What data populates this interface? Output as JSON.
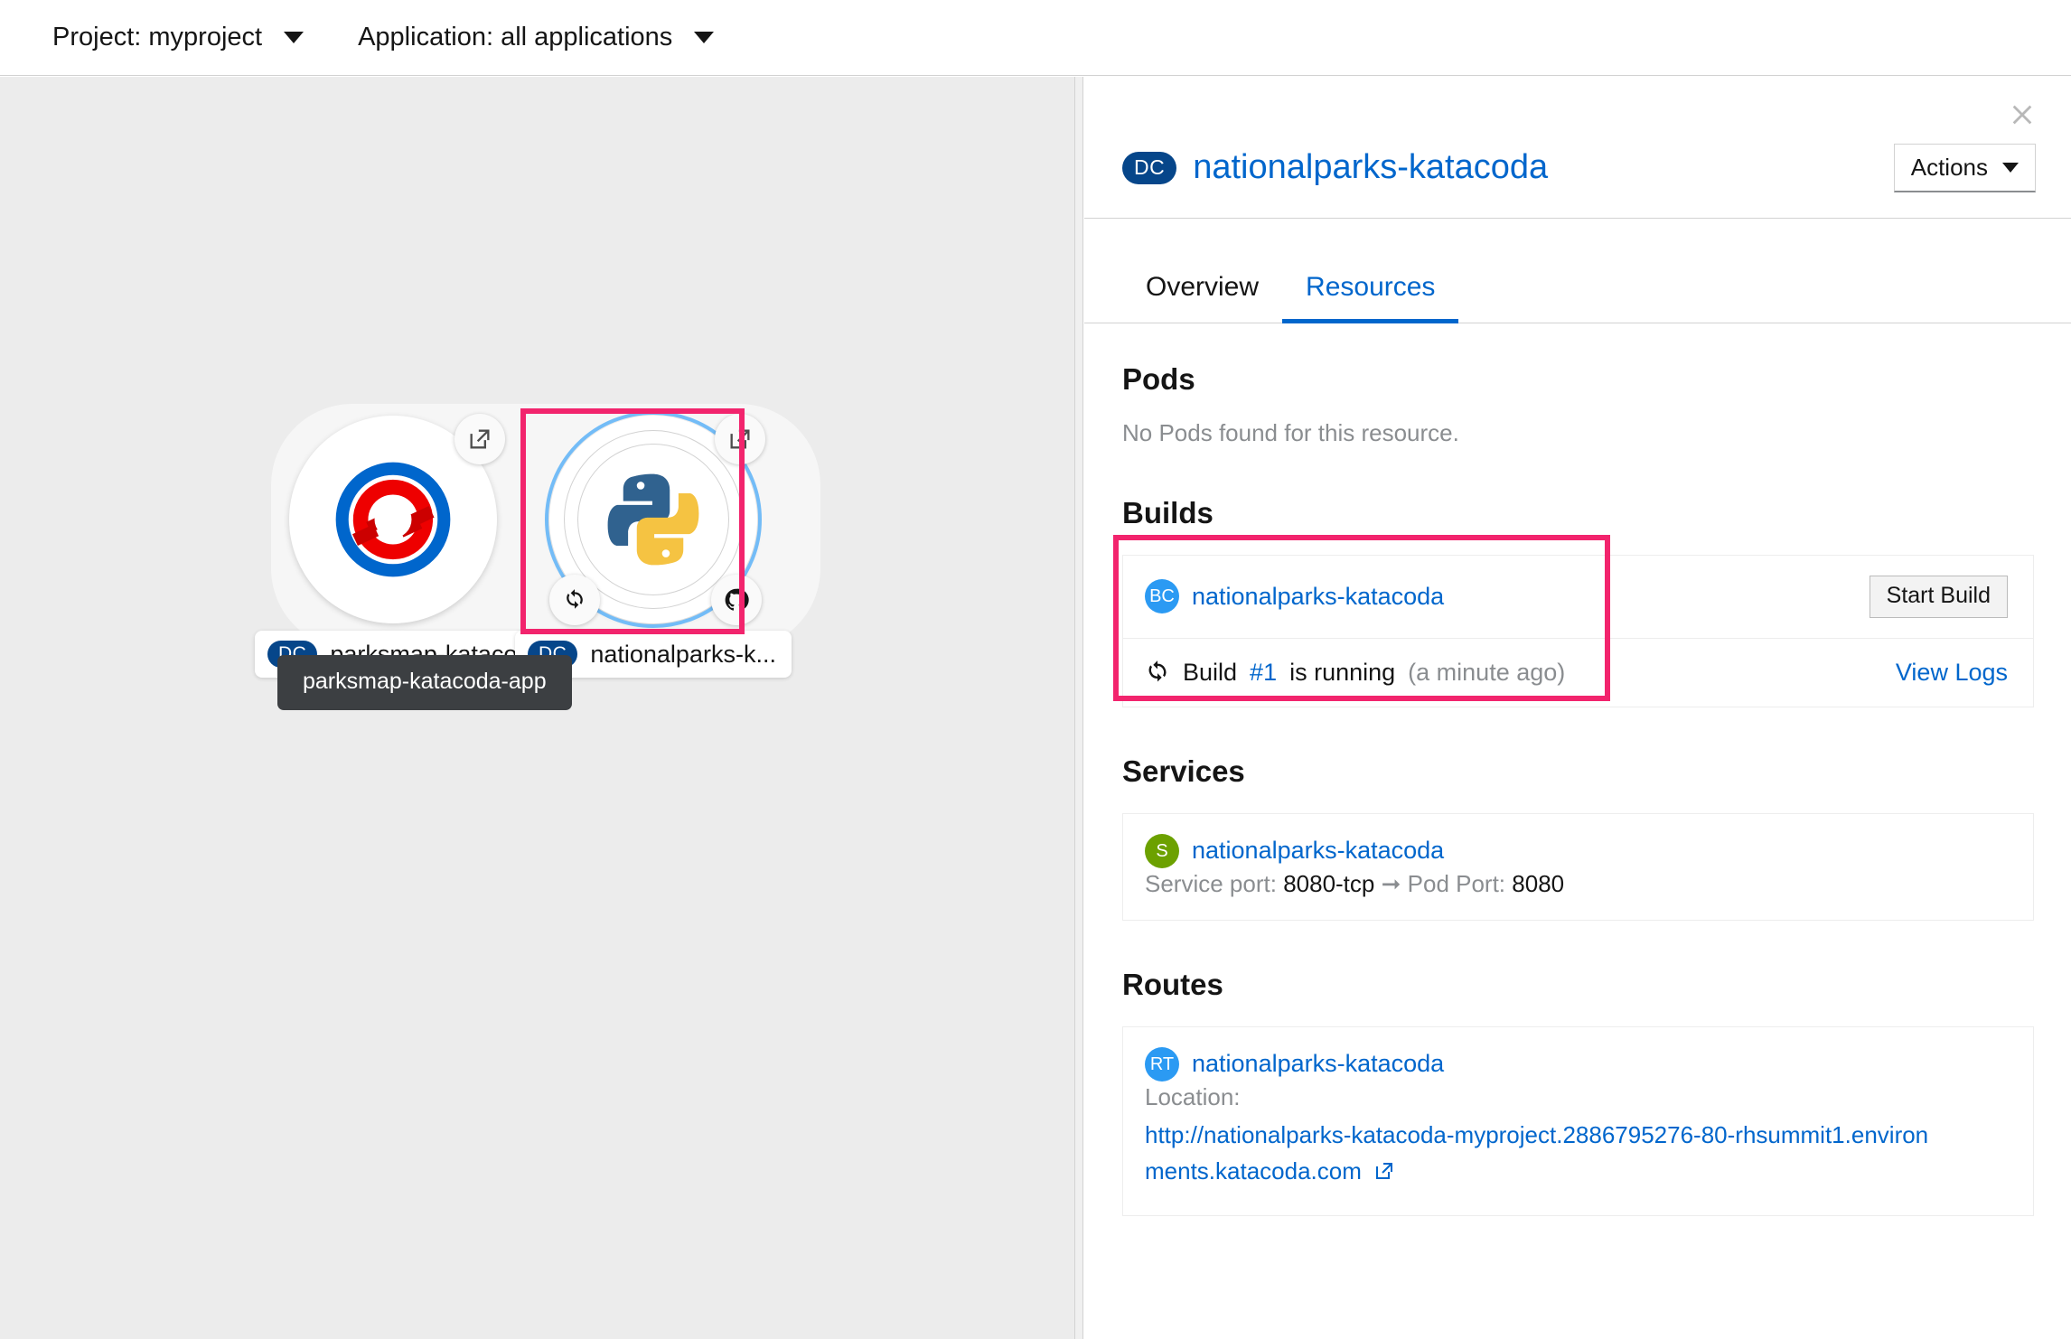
{
  "topbar": {
    "project_filter": "Project: myproject",
    "application_filter": "Application: all applications",
    "caret_icon": "chevron-down-icon"
  },
  "topology": {
    "group_label": "parksmap-katacoda-app",
    "highlight_color": "#f2246d",
    "nodes": [
      {
        "id": "parksmap-katacoda",
        "kind_chip": "DC",
        "label": "parksmap-kataco...",
        "icon": "openshift-logo-icon",
        "badges": [
          "external-link-icon"
        ],
        "selected": false
      },
      {
        "id": "nationalparks-katacoda",
        "kind_chip": "DC",
        "label": "nationalparks-k...",
        "icon": "python-logo-icon",
        "badges": [
          "external-link-icon",
          "build-running-icon",
          "github-icon"
        ],
        "selected": true
      }
    ]
  },
  "sidepanel": {
    "close_icon": "close-icon",
    "kind_chip": "DC",
    "title": "nationalparks-katacoda",
    "actions_label": "Actions",
    "actions_caret": "chevron-down-icon",
    "tabs": [
      {
        "label": "Overview",
        "active": false
      },
      {
        "label": "Resources",
        "active": true
      }
    ],
    "pods": {
      "title": "Pods",
      "empty_message": "No Pods found for this resource."
    },
    "builds": {
      "title": "Builds",
      "highlighted": true,
      "buildconfig": {
        "chip": "BC",
        "chip_color": "#2b9af3",
        "name": "nationalparks-katacoda",
        "action_label": "Start Build"
      },
      "latest_build": {
        "status_icon": "sync-running-icon",
        "prefix": "Build",
        "number": "#1",
        "state": "is running",
        "time": "(a minute ago)",
        "action_label": "View Logs"
      }
    },
    "services": {
      "title": "Services",
      "chip": "S",
      "chip_color": "#6ca100",
      "name": "nationalparks-katacoda",
      "service_port_label": "Service port:",
      "service_port_value": "8080-tcp",
      "arrow_icon": "arrow-right-icon",
      "pod_port_label": "Pod Port:",
      "pod_port_value": "8080"
    },
    "routes": {
      "title": "Routes",
      "chip": "RT",
      "chip_color": "#2b9af3",
      "name": "nationalparks-katacoda",
      "location_label": "Location:",
      "url": "http://nationalparks-katacoda-myproject.2886795276-80-rhsummit1.environments.katacoda.com",
      "external_icon": "external-link-icon"
    }
  }
}
